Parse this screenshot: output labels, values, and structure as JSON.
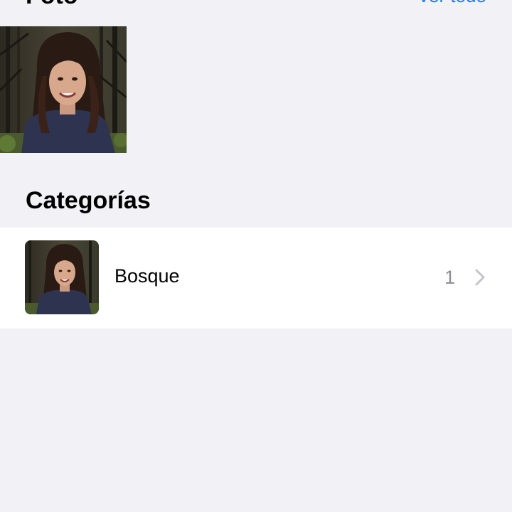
{
  "photos_section": {
    "title": "Foto",
    "see_all_label": "Ver todo"
  },
  "categories_section": {
    "title": "Categorías",
    "items": [
      {
        "label": "Bosque",
        "count": "1"
      }
    ]
  },
  "icons": {
    "chevron": "chevron-right-icon"
  },
  "colors": {
    "background": "#f1f1f6",
    "link": "#1a7cf2",
    "secondary_text": "#8e8e93",
    "chevron": "#c4c4c9"
  }
}
